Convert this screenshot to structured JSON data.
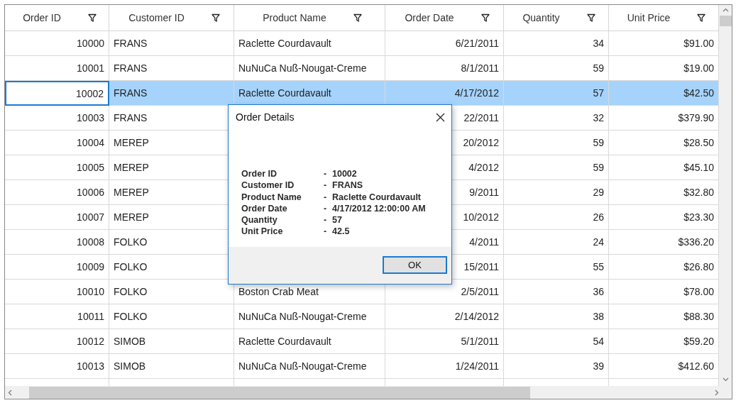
{
  "grid": {
    "columns": [
      {
        "label": "Order ID"
      },
      {
        "label": "Customer ID"
      },
      {
        "label": "Product Name"
      },
      {
        "label": "Order Date"
      },
      {
        "label": "Quantity"
      },
      {
        "label": "Unit Price"
      }
    ],
    "rows": [
      {
        "cells": [
          "10000",
          "FRANS",
          "Raclette Courdavault",
          "6/21/2011",
          "34",
          "$91.00"
        ],
        "selected": false,
        "focused": false
      },
      {
        "cells": [
          "10001",
          "FRANS",
          "NuNuCa Nuß-Nougat-Creme",
          "8/1/2011",
          "59",
          "$19.00"
        ],
        "selected": false,
        "focused": false
      },
      {
        "cells": [
          "10002",
          "FRANS",
          "Raclette Courdavault",
          "4/17/2012",
          "57",
          "$42.50"
        ],
        "selected": true,
        "focused": true
      },
      {
        "cells": [
          "10003",
          "FRANS",
          null,
          "22/2011",
          "32",
          "$379.90"
        ],
        "selected": false,
        "focused": false
      },
      {
        "cells": [
          "10004",
          "MEREP",
          null,
          "20/2012",
          "59",
          "$28.50"
        ],
        "selected": false,
        "focused": false
      },
      {
        "cells": [
          "10005",
          "MEREP",
          null,
          "4/2012",
          "59",
          "$45.10"
        ],
        "selected": false,
        "focused": false
      },
      {
        "cells": [
          "10006",
          "MEREP",
          null,
          "9/2011",
          "29",
          "$32.80"
        ],
        "selected": false,
        "focused": false
      },
      {
        "cells": [
          "10007",
          "MEREP",
          null,
          "10/2012",
          "26",
          "$23.30"
        ],
        "selected": false,
        "focused": false
      },
      {
        "cells": [
          "10008",
          "FOLKO",
          null,
          "4/2011",
          "24",
          "$336.20"
        ],
        "selected": false,
        "focused": false
      },
      {
        "cells": [
          "10009",
          "FOLKO",
          null,
          "15/2011",
          "55",
          "$26.80"
        ],
        "selected": false,
        "focused": false
      },
      {
        "cells": [
          "10010",
          "FOLKO",
          "Boston Crab Meat",
          "2/5/2011",
          "36",
          "$78.00"
        ],
        "selected": false,
        "focused": false
      },
      {
        "cells": [
          "10011",
          "FOLKO",
          "NuNuCa Nuß-Nougat-Creme",
          "2/14/2012",
          "38",
          "$88.30"
        ],
        "selected": false,
        "focused": false
      },
      {
        "cells": [
          "10012",
          "SIMOB",
          "Raclette Courdavault",
          "5/1/2011",
          "54",
          "$59.20"
        ],
        "selected": false,
        "focused": false
      },
      {
        "cells": [
          "10013",
          "SIMOB",
          "NuNuCa Nuß-Nougat-Creme",
          "1/24/2011",
          "39",
          "$412.60"
        ],
        "selected": false,
        "focused": false
      },
      {
        "cells": [
          null,
          null,
          null,
          null,
          null,
          null
        ],
        "selected": false,
        "focused": false
      }
    ]
  },
  "dialog": {
    "title": "Order Details",
    "fields": [
      {
        "label": "Order ID",
        "separator": "-",
        "value": "10002"
      },
      {
        "label": "Customer ID",
        "separator": "-",
        "value": "FRANS"
      },
      {
        "label": "Product Name",
        "separator": "-",
        "value": "Raclette Courdavault"
      },
      {
        "label": "Order Date",
        "separator": "-",
        "value": "4/17/2012 12:00:00 AM"
      },
      {
        "label": "Quantity",
        "separator": "-",
        "value": "57"
      },
      {
        "label": "Unit Price",
        "separator": "-",
        "value": "42.5"
      }
    ],
    "button": "OK"
  }
}
